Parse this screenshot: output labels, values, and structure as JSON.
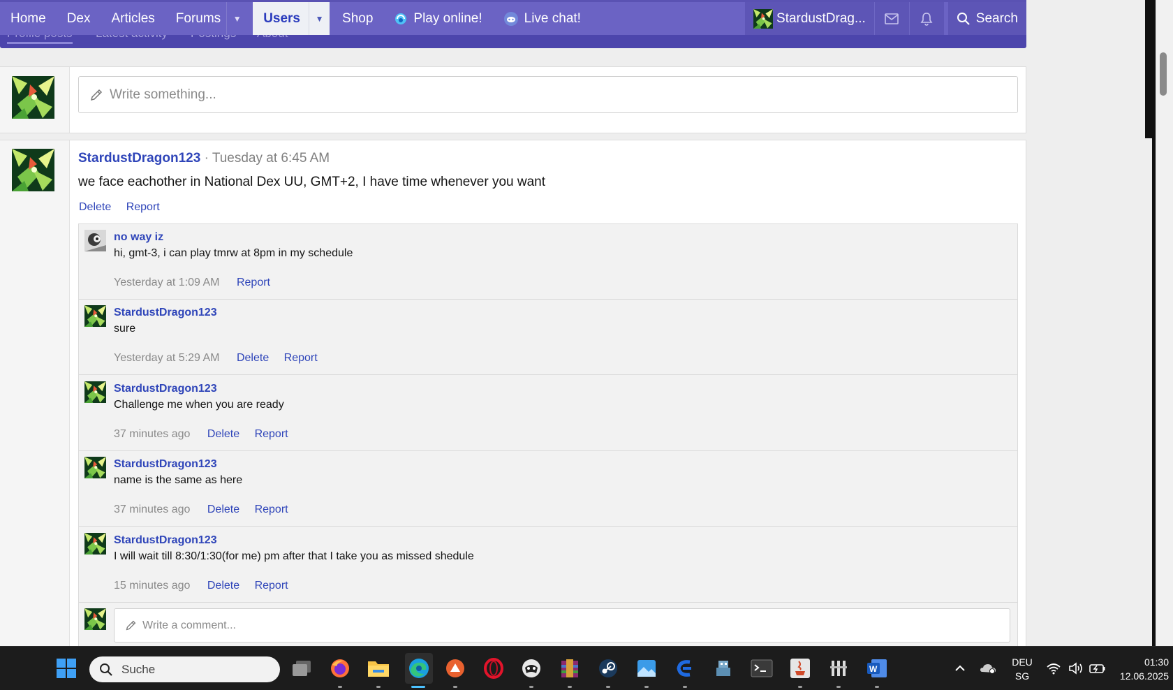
{
  "nav": {
    "home": "Home",
    "dex": "Dex",
    "articles": "Articles",
    "forums": "Forums",
    "users": "Users",
    "shop": "Shop",
    "play_online": "Play online!",
    "live_chat": "Live chat!",
    "user": "StardustDrag...",
    "search": "Search"
  },
  "subnav": {
    "tabs": [
      "Profile posts",
      "Latest activity",
      "Postings",
      "About"
    ]
  },
  "composer": {
    "placeholder": "Write something..."
  },
  "post": {
    "author": "StardustDragon123",
    "separator": "·",
    "time": "Tuesday at 6:45 AM",
    "body": "we face eachother in National Dex UU, GMT+2, I have time whenever you want",
    "delete": "Delete",
    "report": "Report"
  },
  "comments": [
    {
      "author": "no way iz",
      "text": "hi, gmt-3, i can play tmrw at 8pm in my schedule",
      "time": "Yesterday at 1:09 AM",
      "report": "Report"
    },
    {
      "author": "StardustDragon123",
      "text": "sure",
      "time": "Yesterday at 5:29 AM",
      "delete": "Delete",
      "report": "Report"
    },
    {
      "author": "StardustDragon123",
      "text": "Challenge me when you are ready",
      "time": "37 minutes ago",
      "delete": "Delete",
      "report": "Report"
    },
    {
      "author": "StardustDragon123",
      "text": "name is the same as here",
      "time": "37 minutes ago",
      "delete": "Delete",
      "report": "Report"
    },
    {
      "author": "StardustDragon123",
      "text": "I will wait till 8:30/1:30(for me) pm after that I take you as missed shedule",
      "time": "15 minutes ago",
      "delete": "Delete",
      "report": "Report"
    }
  ],
  "comment_input": {
    "placeholder": "Write a comment..."
  },
  "taskbar": {
    "search_placeholder": "Suche",
    "apps": [
      "start-icon",
      "task-view-icon",
      "firefox-icon",
      "file-explorer-icon",
      "edge-icon",
      "app-orange-icon",
      "opera-icon",
      "app-gamepad-icon",
      "winrar-icon",
      "steam-icon",
      "photos-icon",
      "app-blue-icon",
      "app-robot-icon",
      "terminal-icon",
      "java-icon",
      "app-tool-icon",
      "word-icon"
    ],
    "language": "DEU",
    "layout": "SG",
    "time": "01:30",
    "date": "12.06.2025"
  },
  "colors": {
    "nav_bg": "#6b63c4",
    "subnav_bg": "#4c45ac",
    "link": "#2f45b9",
    "taskbar_bg": "#1c1c1c"
  }
}
